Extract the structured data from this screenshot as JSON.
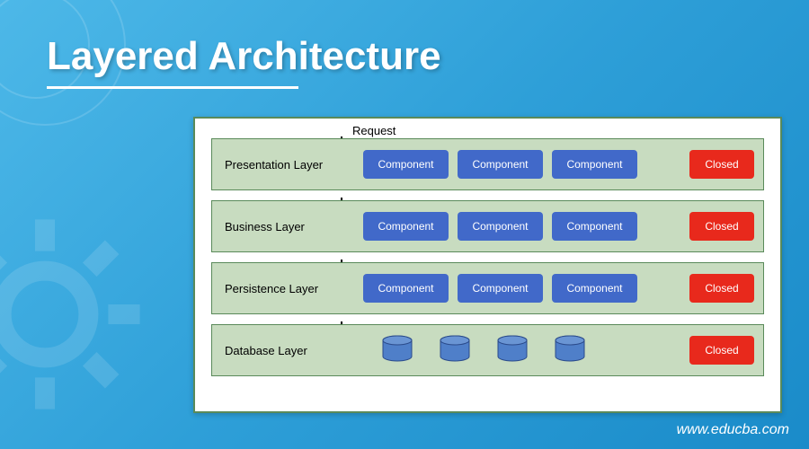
{
  "title": "Layered Architecture",
  "request_label": "Request",
  "layers": [
    {
      "name": "Presentation Layer",
      "status": "Closed",
      "items": [
        "Component",
        "Component",
        "Component"
      ]
    },
    {
      "name": "Business Layer",
      "status": "Closed",
      "items": [
        "Component",
        "Component",
        "Component"
      ]
    },
    {
      "name": "Persistence Layer",
      "status": "Closed",
      "items": [
        "Component",
        "Component",
        "Component"
      ]
    },
    {
      "name": "Database Layer",
      "status": "Closed",
      "db_count": 4
    }
  ],
  "watermark": "www.educba.com"
}
